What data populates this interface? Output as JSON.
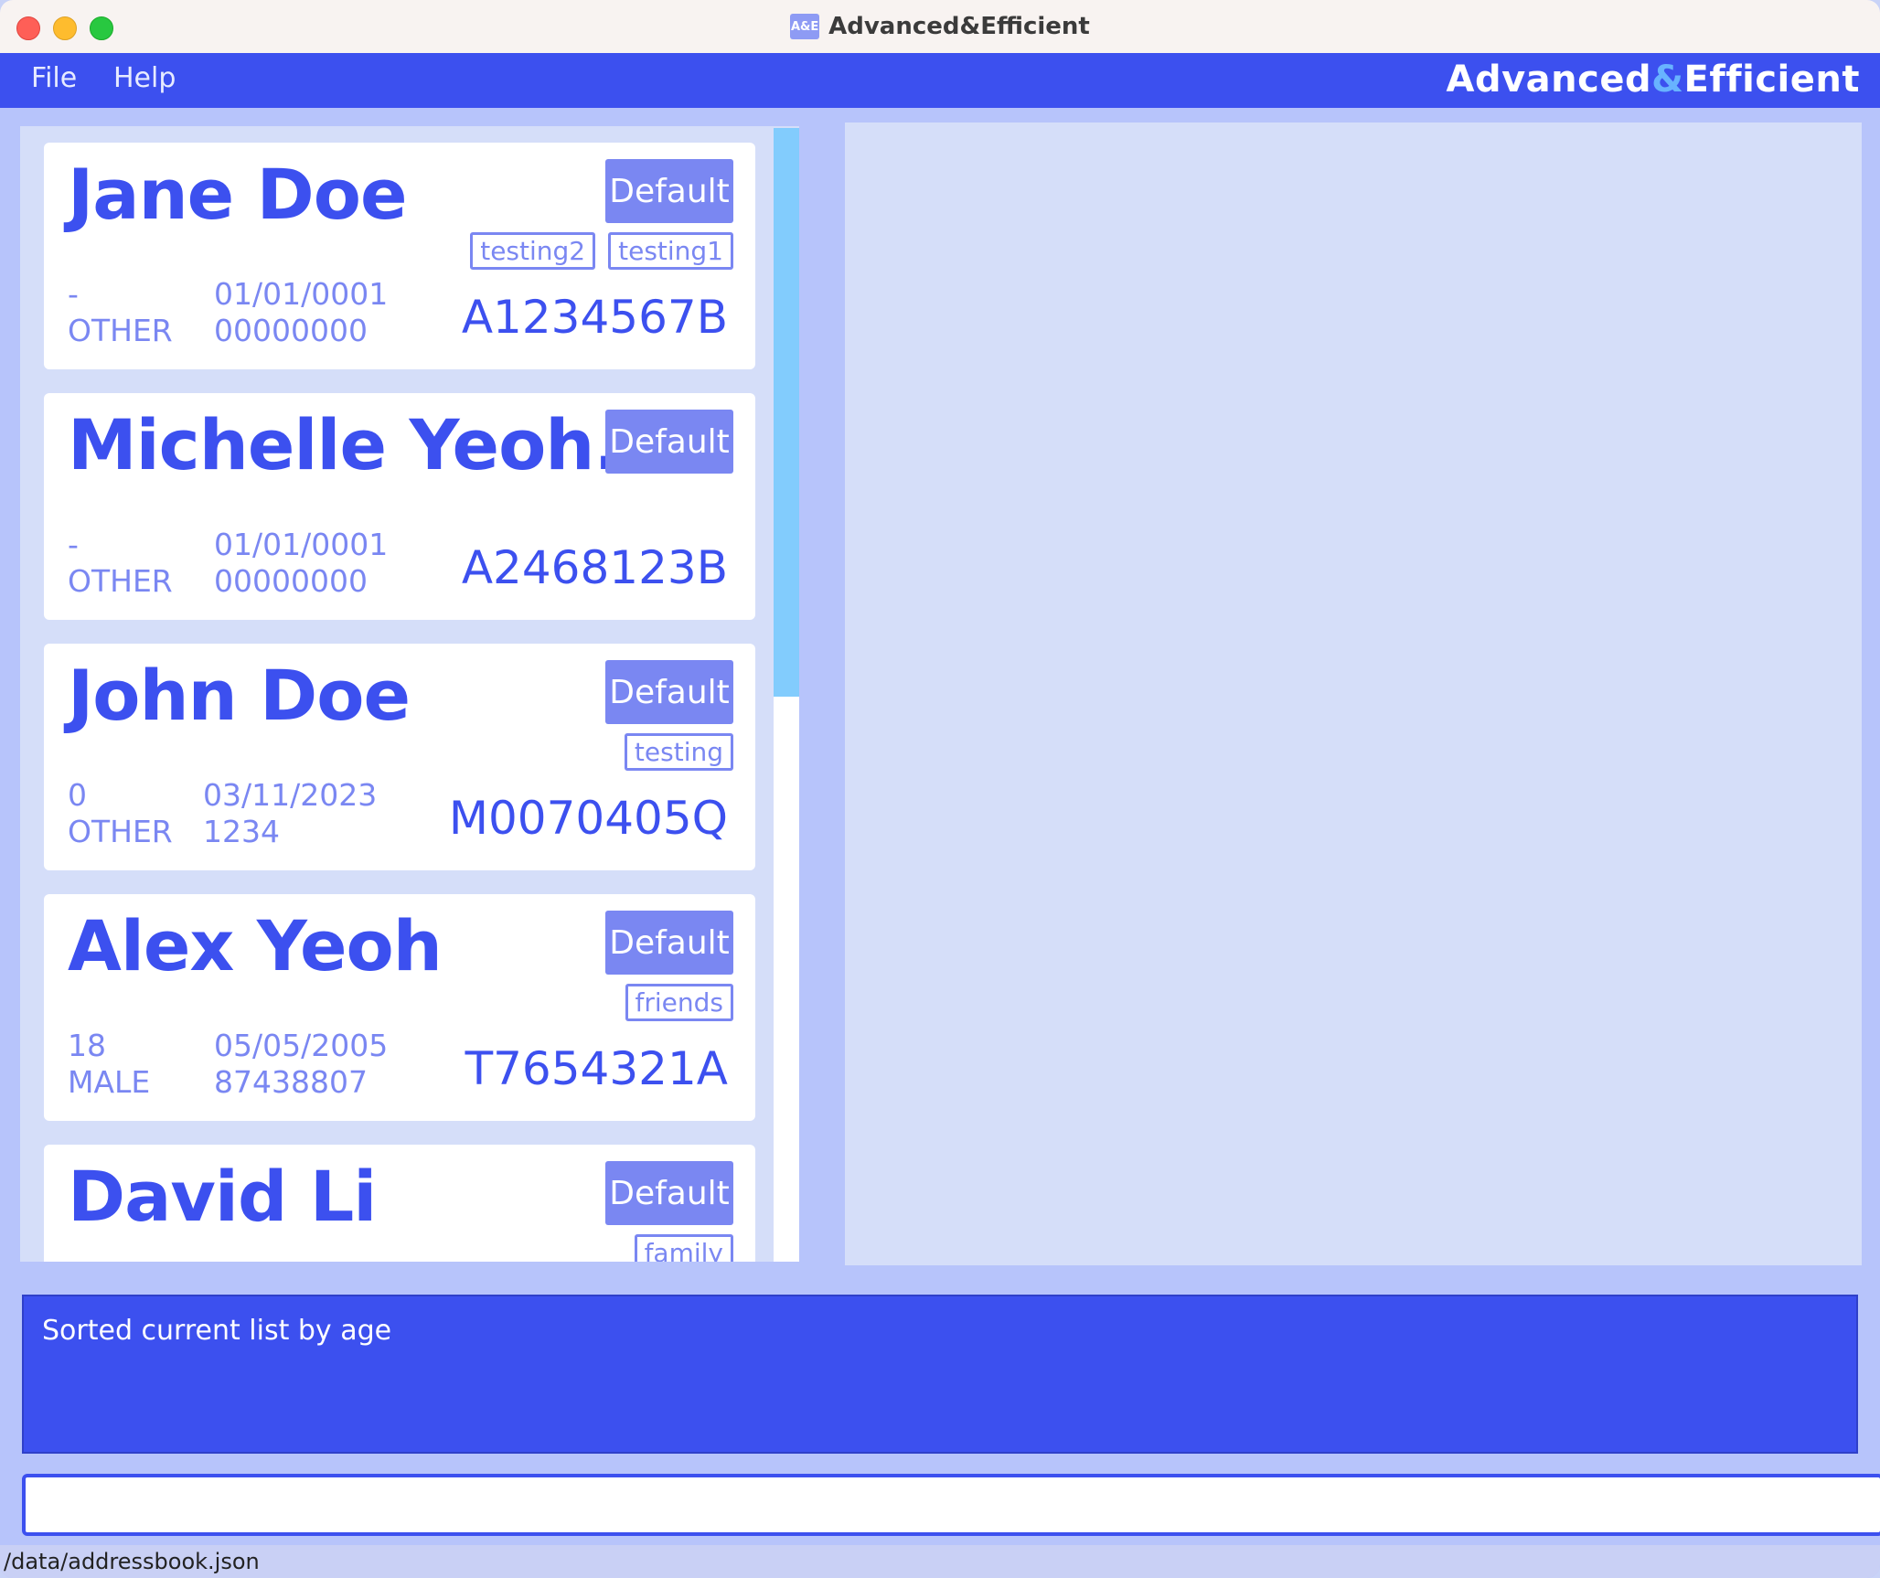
{
  "window": {
    "title": "Advanced&Efficient",
    "icon_text": "A&E"
  },
  "menu": {
    "file": "File",
    "help": "Help",
    "brand_left": "Advanced",
    "brand_amp": "&",
    "brand_right": "Efficient"
  },
  "persons": [
    {
      "name": "Jane Doe",
      "priority": "Default",
      "tags": [
        "testing2",
        "testing1"
      ],
      "age": "-",
      "gender": "OTHER",
      "dob": "01/01/0001",
      "phone": "00000000",
      "nric": "A1234567B"
    },
    {
      "name": "Michelle Yeoh...",
      "priority": "Default",
      "tags": [],
      "age": "-",
      "gender": "OTHER",
      "dob": "01/01/0001",
      "phone": "00000000",
      "nric": "A2468123B"
    },
    {
      "name": "John Doe",
      "priority": "Default",
      "tags": [
        "testing"
      ],
      "age": "0",
      "gender": "OTHER",
      "dob": "03/11/2023",
      "phone": "1234",
      "nric": "M0070405Q"
    },
    {
      "name": "Alex Yeoh",
      "priority": "Default",
      "tags": [
        "friends"
      ],
      "age": "18",
      "gender": "MALE",
      "dob": "05/05/2005",
      "phone": "87438807",
      "nric": "T7654321A"
    },
    {
      "name": "David Li",
      "priority": "Default",
      "tags": [
        "family"
      ],
      "age": "",
      "gender": "",
      "dob": "",
      "phone": "",
      "nric": ""
    }
  ],
  "result": {
    "message": "Sorted current list by age"
  },
  "command": {
    "value": ""
  },
  "status": {
    "path": "/data/addressbook.json"
  },
  "colors": {
    "primary": "#3c50ef",
    "accent": "#7a87f2",
    "panel": "#d5def9",
    "scroll_thumb": "#82ccfd"
  }
}
